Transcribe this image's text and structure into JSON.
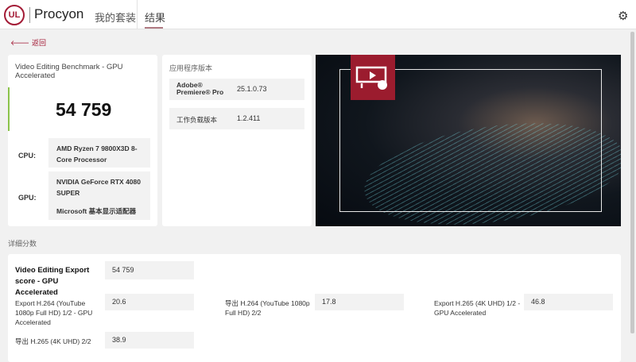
{
  "header": {
    "brand": "Procyon",
    "logo": "UL",
    "nav": [
      "我的套装",
      "结果"
    ]
  },
  "back_label": "返回",
  "summary": {
    "title": "Video Editing Benchmark - GPU Accelerated",
    "score": "54 759",
    "cpu_label": "CPU:",
    "cpu": "AMD Ryzen 7 9800X3D 8-Core Processor",
    "gpu_label": "GPU:",
    "gpu1": "NVIDIA GeForce RTX 4080 SUPER",
    "gpu2": "Microsoft 基本显示适配器"
  },
  "versions": {
    "title": "应用程序版本",
    "rows": [
      {
        "label": "Adobe® Premiere® Pro",
        "value": "25.1.0.73"
      },
      {
        "label": "工作负载版本",
        "value": "1.2.411"
      }
    ]
  },
  "details": {
    "title": "详细分数",
    "main_label": "Video Editing Export score - GPU Accelerated",
    "main_value": "54 759",
    "items": [
      {
        "label": "Export H.264 (YouTube 1080p Full HD) 1/2 - GPU Accelerated",
        "value": "20.6"
      },
      {
        "label": "导出 H.264 (YouTube 1080p Full HD) 2/2",
        "value": "17.8"
      },
      {
        "label": "Export H.265 (4K UHD) 1/2 - GPU Accelerated",
        "value": "46.8"
      },
      {
        "label": "导出 H.265 (4K UHD) 2/2",
        "value": "38.9"
      }
    ]
  },
  "colors": {
    "accent": "#a31b36",
    "score_bar": "#8bc34a"
  }
}
